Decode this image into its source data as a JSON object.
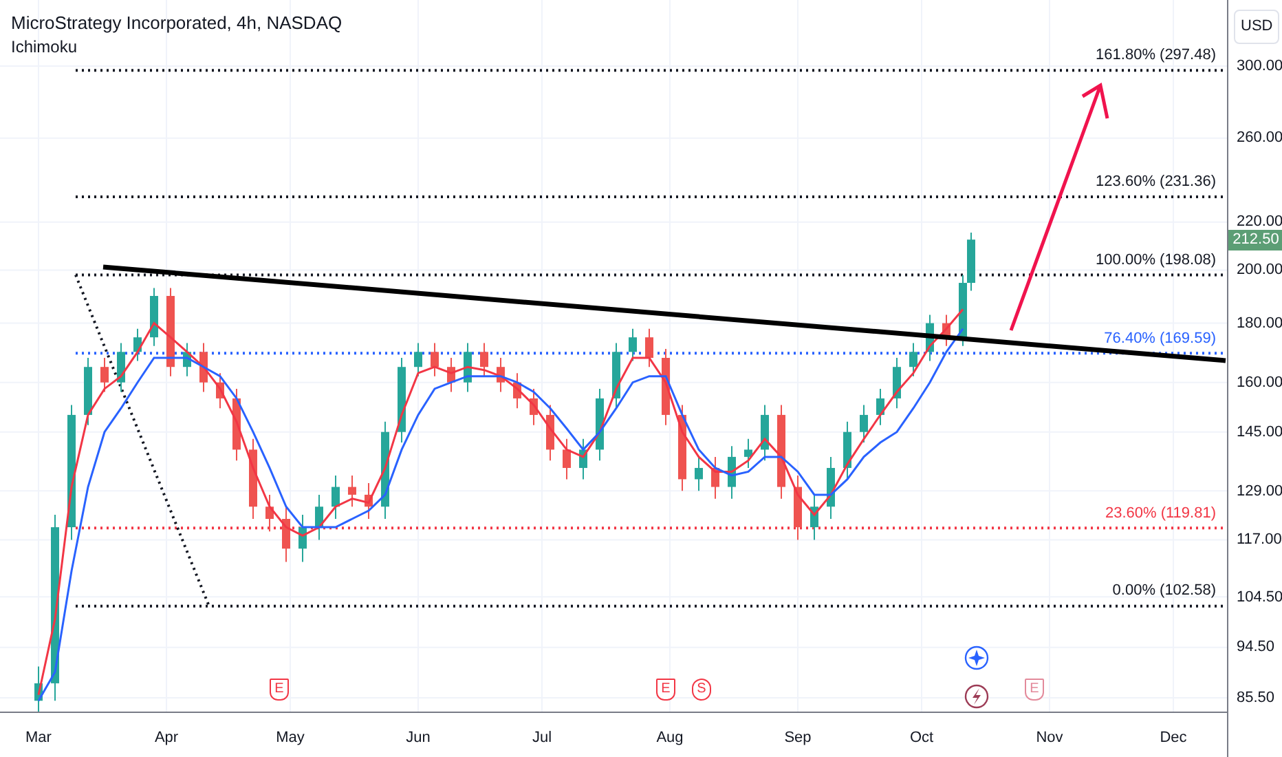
{
  "header": {
    "title": "MicroStrategy Incorporated, 4h, NASDAQ",
    "indicator": "Ichimoku"
  },
  "currency": "USD",
  "last_price": {
    "label": "212.50",
    "color": "#5c9e75"
  },
  "price_axis": [
    "300.00",
    "260.00",
    "220.00",
    "200.00",
    "180.00",
    "160.00",
    "145.00",
    "129.00",
    "117.00",
    "104.50",
    "94.50",
    "85.50"
  ],
  "time_axis": [
    "Mar",
    "Apr",
    "May",
    "Jun",
    "Jul",
    "Aug",
    "Sep",
    "Oct",
    "Nov",
    "Dec"
  ],
  "fib_levels": [
    {
      "label": "161.80% (297.48)",
      "color": "#131722"
    },
    {
      "label": "123.60% (231.36)",
      "color": "#131722"
    },
    {
      "label": "100.00% (198.08)",
      "color": "#131722"
    },
    {
      "label": "76.40% (169.59)",
      "color": "#2962ff"
    },
    {
      "label": "23.60% (119.81)",
      "color": "#f23645"
    },
    {
      "label": "0.00% (102.58)",
      "color": "#131722"
    }
  ],
  "events": [
    {
      "kind": "earnings",
      "label": "E",
      "past": true
    },
    {
      "kind": "earnings",
      "label": "E",
      "past": true
    },
    {
      "kind": "split",
      "label": "S",
      "past": true
    },
    {
      "kind": "earnings",
      "label": "E",
      "past": false
    }
  ]
}
